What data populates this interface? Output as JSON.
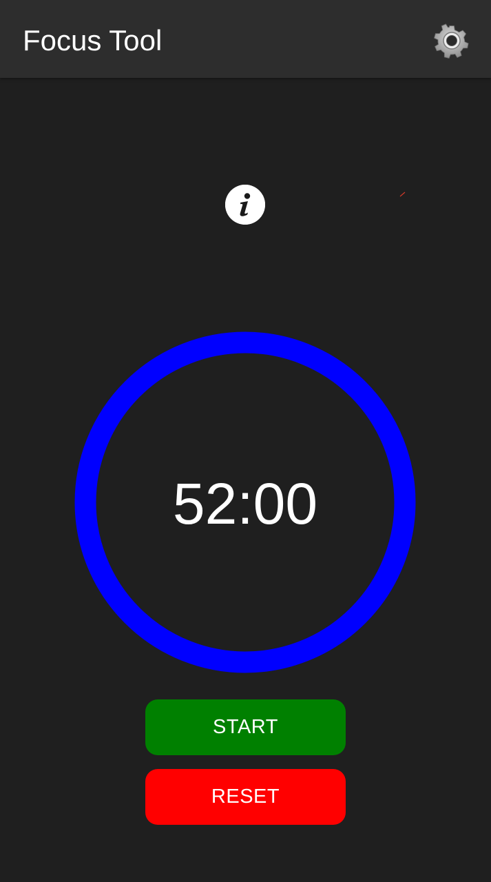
{
  "toolbar": {
    "title": "Focus Tool",
    "settings_icon": "gear-icon"
  },
  "info": {
    "icon": "info-icon",
    "glyph": "i"
  },
  "timer": {
    "display": "52:00",
    "progress": 1.0
  },
  "buttons": {
    "start_label": "START",
    "reset_label": "RESET"
  },
  "colors": {
    "background": "#1f1f1f",
    "toolbar": "#2d2d2d",
    "ring": "#0000ff",
    "start": "#008000",
    "reset": "#ff0000",
    "text": "#ffffff",
    "gear": "#9e9e9e"
  }
}
